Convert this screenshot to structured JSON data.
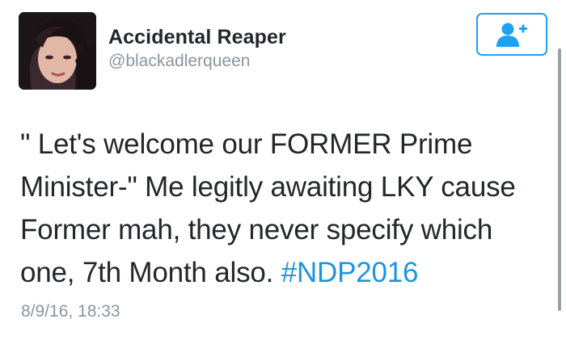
{
  "user": {
    "name": "Accidental Reaper",
    "handle": "@blackadlerqueen"
  },
  "tweet": {
    "lines": [
      "\" Let's welcome our FORMER Prime",
      "Minister-\" Me legitly awaiting LKY cause",
      "Former mah, they never specify which",
      "one, 7th Month also. "
    ],
    "hashtag": "#NDP2016",
    "timestamp": "8/9/16, 18:33"
  },
  "follow_button": {
    "icon": "add-user-icon"
  },
  "colors": {
    "accent": "#1da1f2",
    "link": "#1b95e0",
    "secondary_text": "#8a959e",
    "primary_text": "#23272b"
  }
}
